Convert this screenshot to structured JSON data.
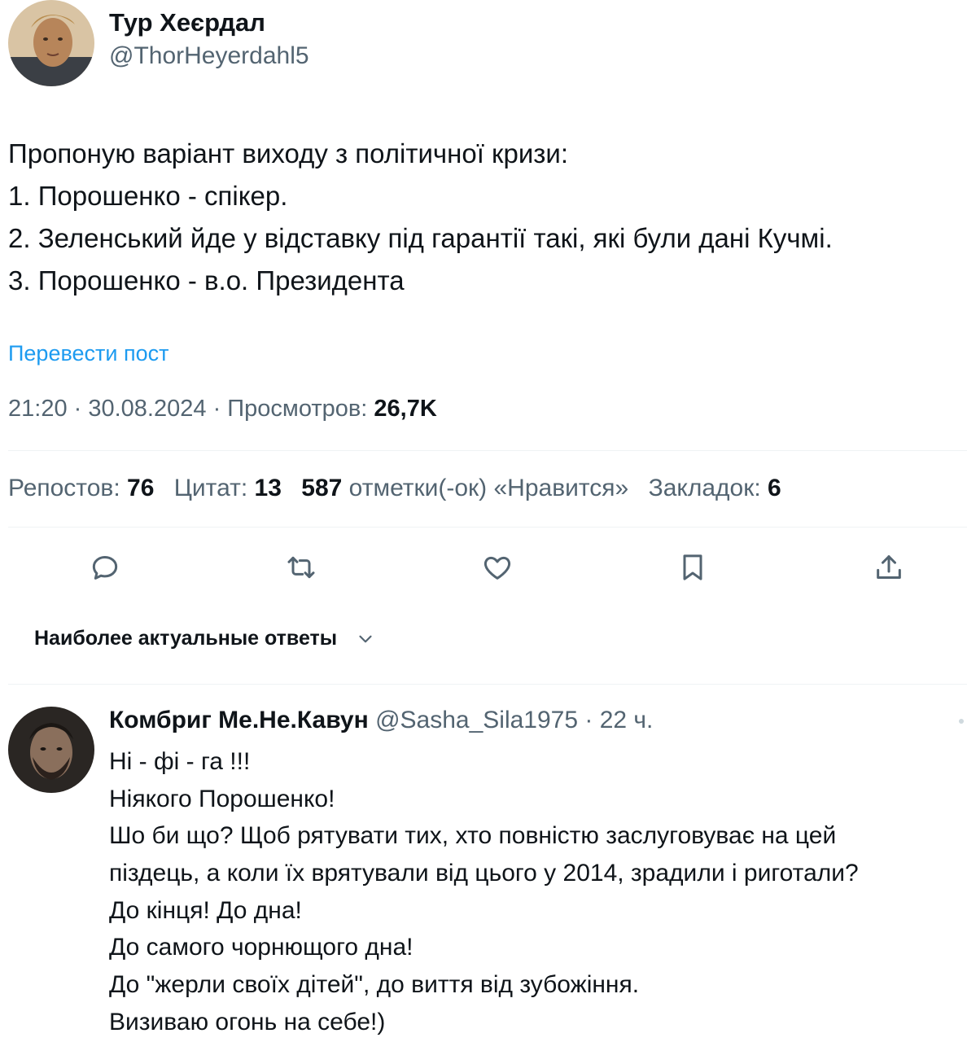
{
  "post": {
    "author_name": "Тур Хеєрдал",
    "author_handle": "@ThorHeyerdahl5",
    "text_lines": [
      "Пропоную варіант виходу з політичної кризи:",
      "1. Порошенко - спікер.",
      "2. Зеленський йде у відставку під гарантії такі, які були дані Кучмі.",
      "3. Порошенко - в.о. Президента"
    ],
    "translate_label": "Перевести пост",
    "time": "21:20",
    "date": "30.08.2024",
    "views_label": "Просмотров:",
    "views_value": "26,7K"
  },
  "stats": {
    "reposts_label": "Репостов:",
    "reposts_value": "76",
    "quotes_label": "Цитат:",
    "quotes_value": "13",
    "likes_value": "587",
    "likes_label": "отметки(-ок) «Нравится»",
    "bookmarks_label": "Закладок:",
    "bookmarks_value": "6"
  },
  "actions": {
    "icons": [
      "reply-icon",
      "retweet-icon",
      "like-icon",
      "bookmark-icon",
      "share-icon"
    ]
  },
  "replies_sort": {
    "label": "Наиболее актуальные ответы",
    "icon": "chevron-down-icon"
  },
  "reply": {
    "author_name": "Комбриг Ме.Не.Кавун",
    "author_handle": "@Sasha_Sila1975",
    "time_ago": "22 ч.",
    "text_lines": [
      "Ні - фі - га !!!",
      "Ніякого Порошенко!",
      "Шо би що? Щоб рятувати тих, хто повністю заслуговуває на цей",
      "піздець, а коли їх врятували від цього у 2014, зрадили і риготали?",
      "До кінця! До дна!",
      "До самого чорнющого дна!",
      "До \"жерли своїх дітей\", до виття від зубожіння.",
      "Визиваю огонь на себе!)"
    ]
  },
  "colors": {
    "text_primary": "#0f1419",
    "text_secondary": "#536471",
    "link": "#1d9bf0",
    "divider": "#eff3f4"
  }
}
